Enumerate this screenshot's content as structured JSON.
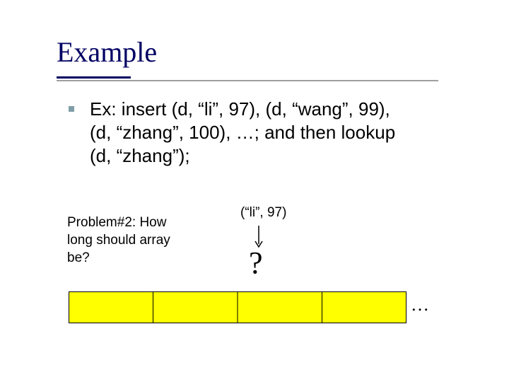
{
  "title": "Example",
  "body_line1": "Ex: insert (d, “li”, 97), (d, “wang”, 99),",
  "body_line2": "(d, “zhang”, 100), …; and then lookup",
  "body_line3": "(d, “zhang”);",
  "problem_line1": "Problem#2: How",
  "problem_line2": "long should array",
  "problem_line3": "be?",
  "li_label": "(“li”, 97)",
  "question_mark": "?",
  "ellipsis": "…"
}
